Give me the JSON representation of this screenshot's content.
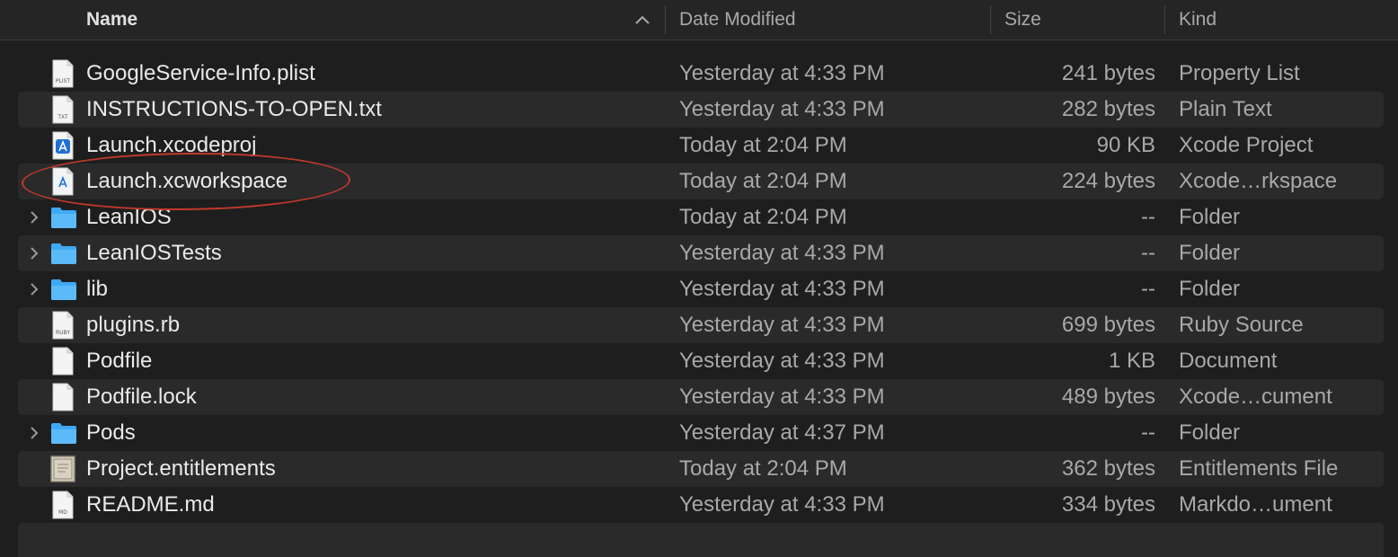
{
  "columns": {
    "name": "Name",
    "date_modified": "Date Modified",
    "size": "Size",
    "kind": "Kind"
  },
  "sort": {
    "column": "name",
    "direction": "ascending"
  },
  "accent_colors": {
    "folder": "#3fa9f5",
    "xcode": "#1f6fd6",
    "annotation_ellipse": "#c0392b"
  },
  "files": [
    {
      "name": "GoogleService-Info.plist",
      "date": "Yesterday at 4:33 PM",
      "size": "241 bytes",
      "kind": "Property List",
      "icon": "plist-file-icon",
      "icon_label": "PLIST",
      "expandable": false
    },
    {
      "name": "INSTRUCTIONS-TO-OPEN.txt",
      "date": "Yesterday at 4:33 PM",
      "size": "282 bytes",
      "kind": "Plain Text",
      "icon": "text-file-icon",
      "icon_label": "TXT",
      "expandable": false
    },
    {
      "name": "Launch.xcodeproj",
      "date": "Today at 2:04 PM",
      "size": "90 KB",
      "kind": "Xcode Project",
      "icon": "xcode-project-icon",
      "icon_label": "",
      "expandable": false
    },
    {
      "name": "Launch.xcworkspace",
      "date": "Today at 2:04 PM",
      "size": "224 bytes",
      "kind": "Xcode…rkspace",
      "icon": "xcode-workspace-icon",
      "icon_label": "",
      "expandable": false
    },
    {
      "name": "LeanIOS",
      "date": "Today at 2:04 PM",
      "size": "--",
      "kind": "Folder",
      "icon": "folder-icon",
      "icon_label": "",
      "expandable": true
    },
    {
      "name": "LeanIOSTests",
      "date": "Yesterday at 4:33 PM",
      "size": "--",
      "kind": "Folder",
      "icon": "folder-icon",
      "icon_label": "",
      "expandable": true
    },
    {
      "name": "lib",
      "date": "Yesterday at 4:33 PM",
      "size": "--",
      "kind": "Folder",
      "icon": "folder-icon",
      "icon_label": "",
      "expandable": true
    },
    {
      "name": "plugins.rb",
      "date": "Yesterday at 4:33 PM",
      "size": "699 bytes",
      "kind": "Ruby Source",
      "icon": "ruby-file-icon",
      "icon_label": "RUBY",
      "expandable": false
    },
    {
      "name": "Podfile",
      "date": "Yesterday at 4:33 PM",
      "size": "1 KB",
      "kind": "Document",
      "icon": "document-file-icon",
      "icon_label": "",
      "expandable": false
    },
    {
      "name": "Podfile.lock",
      "date": "Yesterday at 4:33 PM",
      "size": "489 bytes",
      "kind": "Xcode…cument",
      "icon": "document-file-icon",
      "icon_label": "",
      "expandable": false
    },
    {
      "name": "Pods",
      "date": "Yesterday at 4:37 PM",
      "size": "--",
      "kind": "Folder",
      "icon": "folder-icon",
      "icon_label": "",
      "expandable": true
    },
    {
      "name": "Project.entitlements",
      "date": "Today at 2:04 PM",
      "size": "362 bytes",
      "kind": "Entitlements File",
      "icon": "entitlements-file-icon",
      "icon_label": "",
      "expandable": false
    },
    {
      "name": "README.md",
      "date": "Yesterday at 4:33 PM",
      "size": "334 bytes",
      "kind": "Markdo…ument",
      "icon": "markdown-file-icon",
      "icon_label": "MD",
      "expandable": false
    }
  ],
  "annotation": {
    "circled_file": "Launch.xcworkspace"
  }
}
